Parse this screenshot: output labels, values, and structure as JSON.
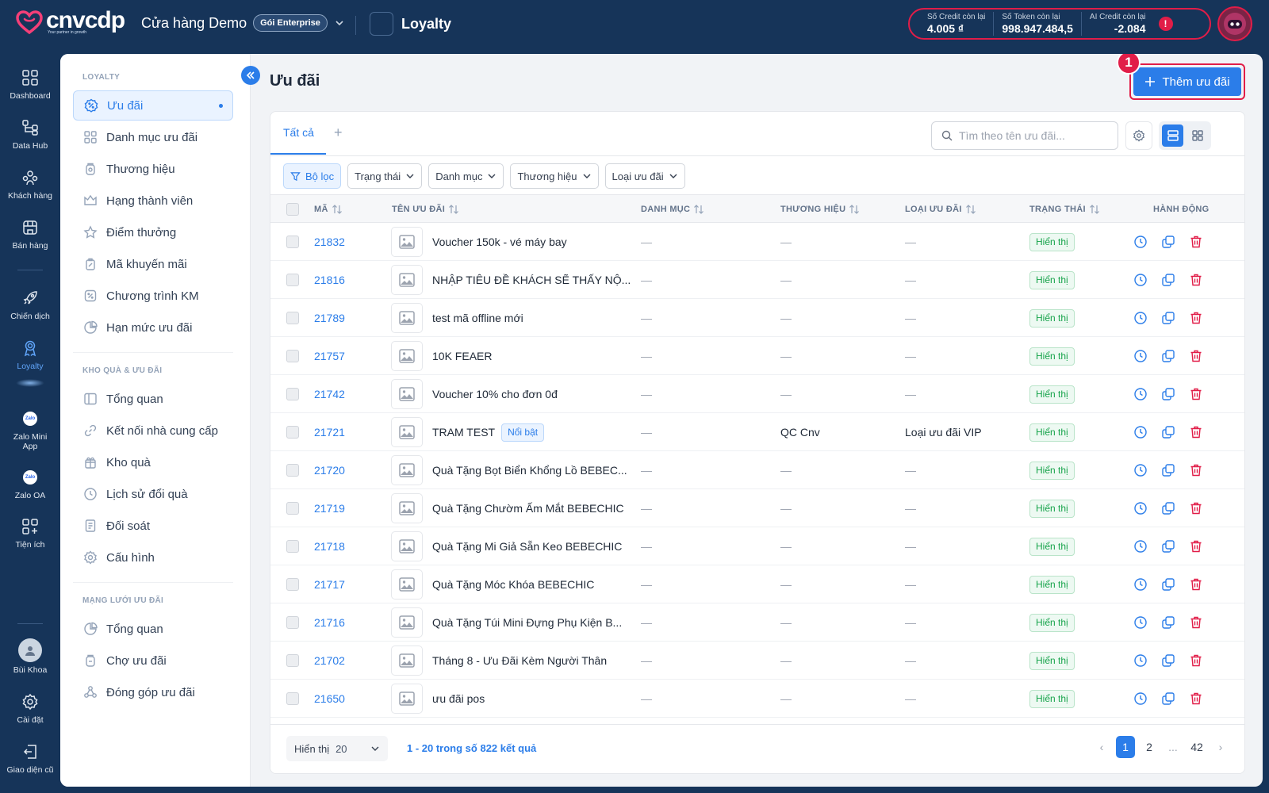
{
  "header": {
    "logo_text": "cnvcdp",
    "logo_tagline": "Your partner in growth",
    "store_name": "Cửa hàng Demo",
    "plan_badge": "Gói Enterprise",
    "module_name": "Loyalty",
    "credits": [
      {
        "label": "Số Credit còn lại",
        "value": "4.005 ₫"
      },
      {
        "label": "Số Token còn lại",
        "value": "998.947.484,5"
      },
      {
        "label": "AI Credit còn lại",
        "value": "-2.084"
      }
    ],
    "info_mark": "!"
  },
  "rail": {
    "items": [
      {
        "label": "Dashboard",
        "icon": "grid-icon"
      },
      {
        "label": "Data Hub",
        "icon": "hub-icon"
      },
      {
        "label": "Khách hàng",
        "icon": "users-icon"
      },
      {
        "label": "Bán hàng",
        "icon": "store-icon"
      },
      {
        "label": "Chiến dịch",
        "icon": "rocket-icon"
      },
      {
        "label": "Loyalty",
        "icon": "award-icon"
      },
      {
        "label": "Zalo Mini App",
        "icon": "zalo-icon"
      },
      {
        "label": "Zalo OA",
        "icon": "zalo-oa-icon"
      },
      {
        "label": "Tiện ích",
        "icon": "grid-plus-icon"
      },
      {
        "label": "Bùi Khoa",
        "icon": "user-icon"
      },
      {
        "label": "Cài đặt",
        "icon": "gear-icon"
      },
      {
        "label": "Giao diện cũ",
        "icon": "back-icon"
      }
    ],
    "zalo_badge": "Zalo"
  },
  "sidebar": {
    "section1": "LOYALTY",
    "items1": [
      "Ưu đãi",
      "Danh mục ưu đãi",
      "Thương hiệu",
      "Hạng thành viên",
      "Điểm thưởng",
      "Mã khuyến mãi",
      "Chương trình KM",
      "Hạn mức ưu đãi"
    ],
    "section2": "KHO QUÀ & ƯU ĐÃI",
    "items2": [
      "Tổng quan",
      "Kết nối nhà cung cấp",
      "Kho quà",
      "Lịch sử đổi quà",
      "Đối soát",
      "Cấu hình"
    ],
    "section3": "MẠNG LƯỚI ƯU ĐÃI",
    "items3": [
      "Tổng quan",
      "Chợ ưu đãi",
      "Đóng góp ưu đãi"
    ]
  },
  "main": {
    "title": "Ưu đãi",
    "add_button": "Thêm ưu đãi",
    "step_marker": "1",
    "tab_all": "Tất cả",
    "tab_add": "+",
    "search_placeholder": "Tìm theo tên ưu đãi...",
    "filters": [
      "Bộ lọc",
      "Trạng thái",
      "Danh mục",
      "Thương hiệu",
      "Loại ưu đãi"
    ],
    "columns": [
      "MÃ",
      "TÊN ƯU ĐÃI",
      "DANH MỤC",
      "THƯƠNG HIỆU",
      "LOẠI ƯU ĐÃI",
      "TRẠNG THÁI",
      "HÀNH ĐỘNG"
    ],
    "rows": [
      {
        "code": "21832",
        "name": "Voucher 150k - vé máy bay",
        "tag": "",
        "category": "—",
        "brand": "—",
        "type": "—",
        "status": "Hiển thị"
      },
      {
        "code": "21816",
        "name": "NHẬP TIÊU ĐỀ KHÁCH SẼ THẤY NỘ...",
        "tag": "",
        "category": "—",
        "brand": "—",
        "type": "—",
        "status": "Hiển thị"
      },
      {
        "code": "21789",
        "name": "test mã offline mới",
        "tag": "",
        "category": "—",
        "brand": "—",
        "type": "—",
        "status": "Hiển thị"
      },
      {
        "code": "21757",
        "name": "10K FEAER",
        "tag": "",
        "category": "—",
        "brand": "—",
        "type": "—",
        "status": "Hiển thị"
      },
      {
        "code": "21742",
        "name": "Voucher 10% cho đơn 0đ",
        "tag": "",
        "category": "—",
        "brand": "—",
        "type": "—",
        "status": "Hiển thị"
      },
      {
        "code": "21721",
        "name": "TRAM TEST",
        "tag": "Nổi bật",
        "category": "—",
        "brand": "QC Cnv",
        "type": "Loại ưu đãi VIP",
        "status": "Hiển thị"
      },
      {
        "code": "21720",
        "name": "Quà Tặng Bọt Biển Khổng Lồ BEBEC...",
        "tag": "",
        "category": "—",
        "brand": "—",
        "type": "—",
        "status": "Hiển thị"
      },
      {
        "code": "21719",
        "name": "Quà Tặng Chườm Ấm Mắt BEBECHIC",
        "tag": "",
        "category": "—",
        "brand": "—",
        "type": "—",
        "status": "Hiển thị"
      },
      {
        "code": "21718",
        "name": "Quà Tặng Mi Giả Sẵn Keo BEBECHIC",
        "tag": "",
        "category": "—",
        "brand": "—",
        "type": "—",
        "status": "Hiển thị"
      },
      {
        "code": "21717",
        "name": "Quà Tặng Móc Khóa BEBECHIC",
        "tag": "",
        "category": "—",
        "brand": "—",
        "type": "—",
        "status": "Hiển thị"
      },
      {
        "code": "21716",
        "name": "Quà Tặng Túi Mini Đựng Phụ Kiện B...",
        "tag": "",
        "category": "—",
        "brand": "—",
        "type": "—",
        "status": "Hiển thị"
      },
      {
        "code": "21702",
        "name": "Tháng 8 - Ưu Đãi Kèm Người Thân",
        "tag": "",
        "category": "—",
        "brand": "—",
        "type": "—",
        "status": "Hiển thị"
      },
      {
        "code": "21650",
        "name": "ưu đãi pos",
        "tag": "",
        "category": "—",
        "brand": "—",
        "type": "—",
        "status": "Hiển thị"
      }
    ],
    "footer": {
      "per_page_label": "Hiển thị",
      "per_page_value": "20",
      "result_text": "1 - 20 trong số 822 kết quả",
      "pages": [
        "1",
        "2",
        "...",
        "42"
      ],
      "prev": "‹",
      "next": "›"
    }
  }
}
